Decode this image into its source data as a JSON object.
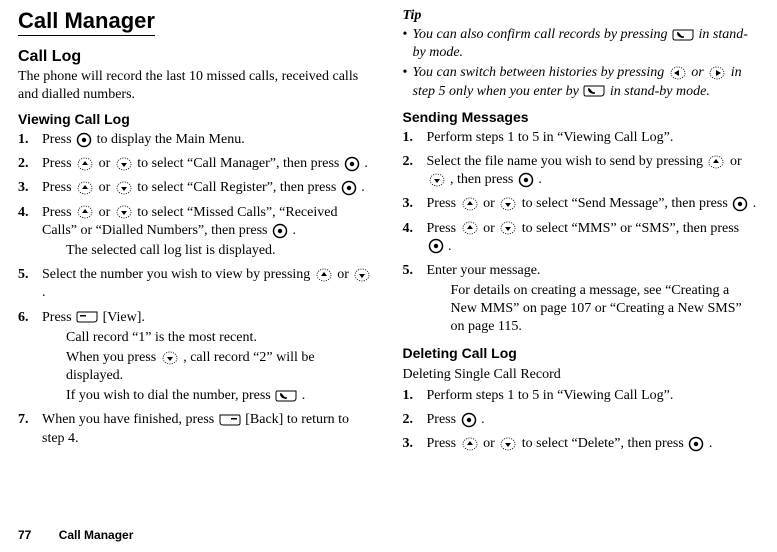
{
  "footer": {
    "page": "77",
    "section": "Call Manager"
  },
  "left": {
    "title": "Call Manager",
    "section": "Call Log",
    "intro": "The phone will record the last 10 missed calls, received calls and dialled numbers.",
    "sub1": "Viewing Call Log",
    "steps": {
      "s1a": "Press ",
      "s1b": " to display the Main Menu.",
      "s2a": "Press ",
      "s2b": " or ",
      "s2c": " to select “Call Manager”, then press ",
      "s2d": ".",
      "s3a": "Press ",
      "s3b": " or ",
      "s3c": " to select “Call Register”, then press ",
      "s3d": ".",
      "s4a": "Press ",
      "s4b": " or ",
      "s4c": " to select “Missed Calls”, “Received Calls” or “Dialled Numbers”, then press ",
      "s4d": ".",
      "s4after": "The selected call log list is displayed.",
      "s5a": "Select the number you wish to view by pressing ",
      "s5b": " or ",
      "s5c": ".",
      "s6a": "Press ",
      "s6b": " [View].",
      "s6after1": "Call record “1” is the most recent.",
      "s6after2a": "When you press ",
      "s6after2b": ", call record “2” will be displayed.",
      "s6after3a": "If you wish to dial the number, press ",
      "s6after3b": ".",
      "s7a": "When you have finished, press ",
      "s7b": " [Back] to return to step 4."
    }
  },
  "right": {
    "tiphead": "Tip",
    "tip1a": "You can also confirm call records by pressing ",
    "tip1b": " in stand-by mode.",
    "tip2a": "You can switch between histories by pressing ",
    "tip2b": " or ",
    "tip2c": " in step 5 only when you enter by ",
    "tip2d": " in stand-by mode.",
    "sub1": "Sending Messages",
    "sm": {
      "s1": "Perform steps 1 to 5 in “Viewing Call Log”.",
      "s2a": "Select the file name you wish to send by pressing ",
      "s2b": " or ",
      "s2c": ", then press ",
      "s2d": ".",
      "s3a": "Press ",
      "s3b": " or ",
      "s3c": " to select “Send Message”, then press ",
      "s3d": ".",
      "s4a": "Press ",
      "s4b": " or ",
      "s4c": " to select “MMS” or “SMS”, then press ",
      "s4d": ".",
      "s5": "Enter your message.",
      "s5after": "For details on creating a message, see “Creating a New MMS” on page 107 or “Creating a New SMS” on page 115."
    },
    "sub2": "Deleting Call Log",
    "sub2b": "Deleting Single Call Record",
    "dl": {
      "s1": "Perform steps 1 to 5 in “Viewing Call Log”.",
      "s2a": "Press ",
      "s2b": ".",
      "s3a": "Press ",
      "s3b": " or ",
      "s3c": " to select “Delete”, then press ",
      "s3d": "."
    }
  }
}
